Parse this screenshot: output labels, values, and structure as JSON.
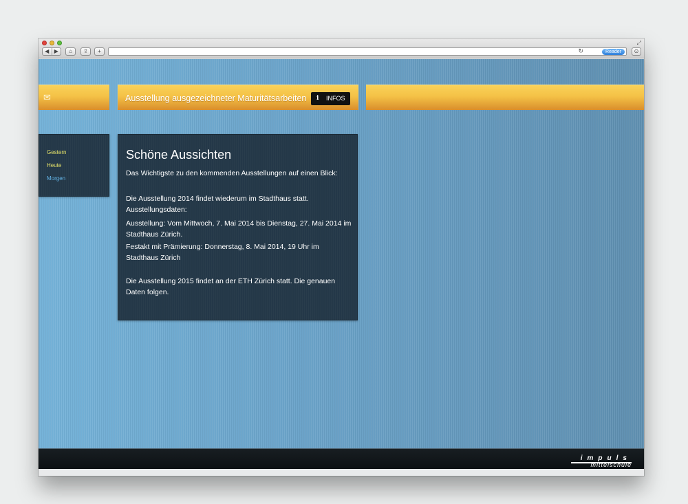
{
  "browser": {
    "back_icon": "◀",
    "forward_icon": "▶",
    "home_icon": "⌂",
    "share_icon": "⇪",
    "add_icon": "+",
    "reload_icon": "↻",
    "reader_label": "Reader",
    "download_icon": "⊙"
  },
  "header": {
    "mail_icon": "✉",
    "title": "Ausstellung ausgezeichneter Maturitätsarbeiten",
    "infos_icon": "i",
    "infos_label": "INFOS"
  },
  "sidebar": {
    "items": [
      {
        "label": "Gestern"
      },
      {
        "label": "Heute"
      },
      {
        "label": "Morgen"
      }
    ]
  },
  "main": {
    "title": "Schöne Aussichten",
    "paragraphs": [
      "Das Wichtigste zu den kommenden Ausstellungen auf einen Blick:",
      "Die Ausstellung 2014 findet wiederum im Stadthaus statt. Ausstellungsdaten:",
      "Ausstellung: Vom Mittwoch, 7. Mai 2014 bis Dienstag, 27. Mai 2014 im Stadthaus Zürich.",
      "Festakt mit Prämierung: Donnerstag, 8. Mai 2014, 19 Uhr im Stadthaus Zürich",
      "Die Ausstellung 2015 findet an der ETH Zürich statt. Die genauen Daten folgen."
    ]
  },
  "footer": {
    "logo_top": "impuls",
    "logo_bottom": "mittelschule"
  },
  "colors": {
    "accent_yellow": "#f4c146",
    "panel_dark": "#243848",
    "link_yellow": "#e6e36a",
    "link_blue": "#63b5e8"
  }
}
